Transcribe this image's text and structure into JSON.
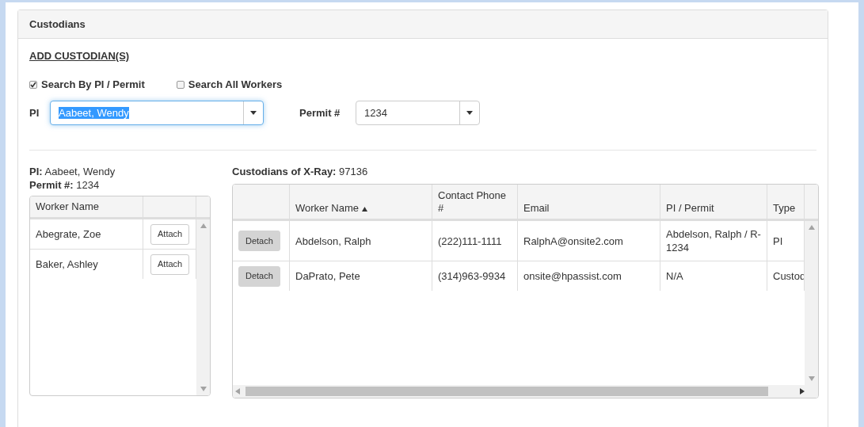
{
  "panel": {
    "title": "Custodians"
  },
  "add_link": "ADD CUSTODIAN(S)",
  "search_options": [
    {
      "label": "Search By PI / Permit",
      "checked": true
    },
    {
      "label": "Search All Workers",
      "checked": false
    }
  ],
  "pi_select": {
    "label": "PI",
    "value": "Aabeet, Wendy",
    "focused": true
  },
  "permit_select": {
    "label": "Permit #",
    "value": "1234",
    "focused": false
  },
  "summary": {
    "pi": "**PI:** Aabeet, Wendy",
    "permit": "**Permit #:** 1234"
  },
  "workers_table": {
    "columns": [
      {
        "label": "Worker Name"
      }
    ],
    "rows": [
      {
        "name": "Abegrate, Zoe",
        "action": "Attach"
      },
      {
        "name": "Baker, Ashley",
        "action": "Attach"
      }
    ]
  },
  "custodians": {
    "title": "**Custodians of X-Ray:** 97136",
    "columns": [
      {
        "label": "Worker Name",
        "sorted": true
      },
      {
        "label": "Contact Phone #",
        "sorted": false
      },
      {
        "label": "Email",
        "sorted": false
      },
      {
        "label": "PI / Permit",
        "sorted": false
      },
      {
        "label": "Type",
        "sorted": false
      }
    ],
    "rows": [
      {
        "action": "Detach",
        "cells": [
          "Abdelson, Ralph",
          "(222)111-1111",
          "RalphA@onsite2.com",
          "Abdelson, Ralph / R-1234",
          "PI"
        ]
      },
      {
        "action": "Detach",
        "cells": [
          "DaPrato, Pete",
          "(314)963-9934",
          "onsite@hpassist.com",
          "N/A",
          "Custod"
        ]
      }
    ]
  }
}
